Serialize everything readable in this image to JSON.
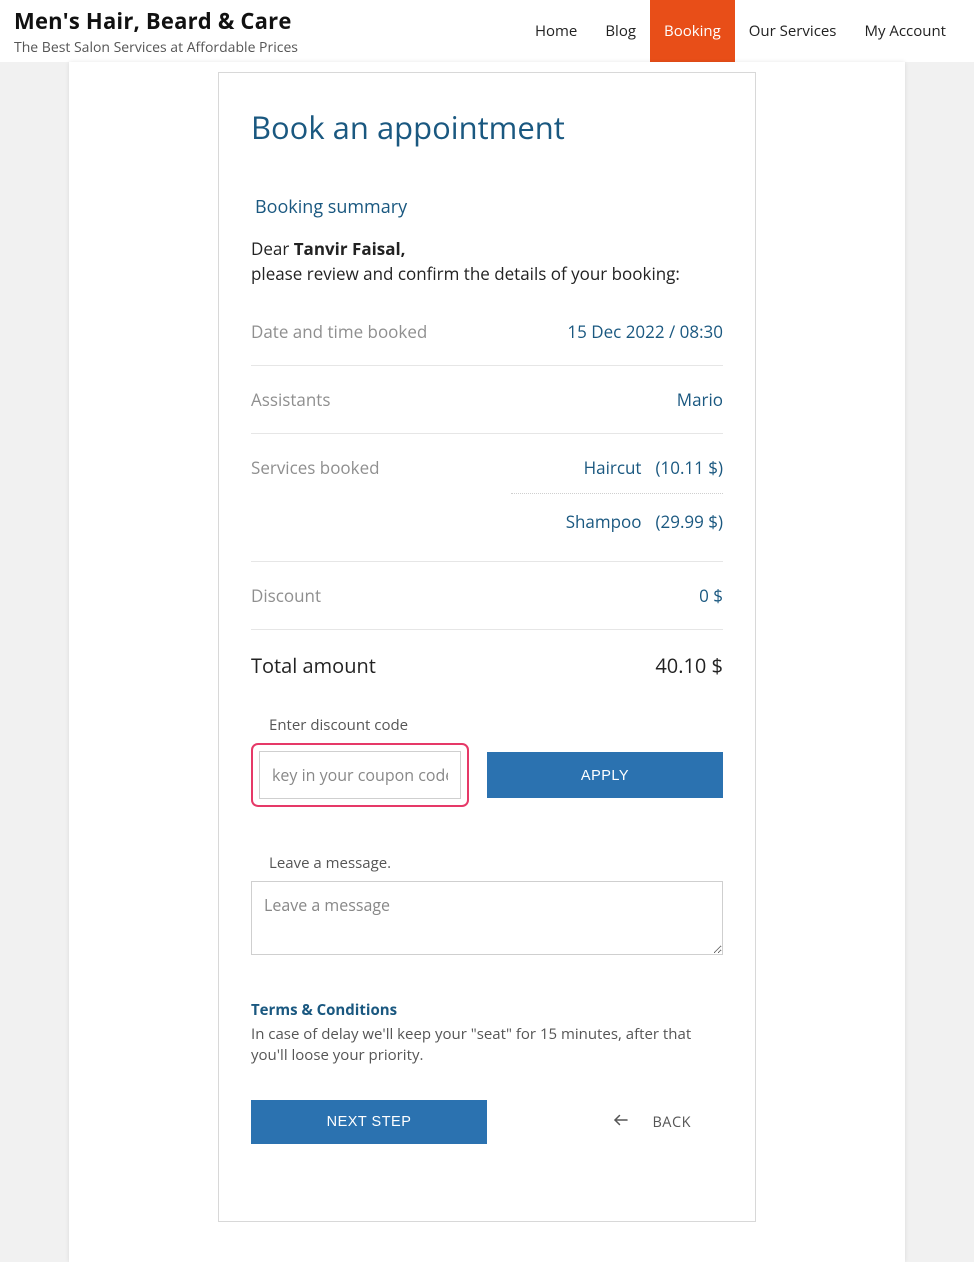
{
  "brand": {
    "title": "Men's Hair, Beard & Care",
    "subtitle": "The Best Salon Services at Affordable Prices"
  },
  "nav": {
    "items": [
      {
        "label": "Home",
        "active": false
      },
      {
        "label": "Blog",
        "active": false
      },
      {
        "label": "Booking",
        "active": true
      },
      {
        "label": "Our Services",
        "active": false
      },
      {
        "label": "My Account",
        "active": false
      }
    ]
  },
  "booking": {
    "title": "Book an appointment",
    "summary_heading": "Booking summary",
    "dear_prefix": "Dear ",
    "customer_name": "Tanvir Faisal,",
    "dear_instruction": "please review and confirm the details of your booking:",
    "date_label": "Date and time booked",
    "date_value": "15 Dec 2022 / 08:30",
    "assistants_label": "Assistants",
    "assistants_value": "Mario",
    "services_label": "Services booked",
    "services": [
      {
        "name": "Haircut",
        "price": "(10.11 $)"
      },
      {
        "name": "Shampoo",
        "price": "(29.99 $)"
      }
    ],
    "discount_label": "Discount",
    "discount_value": "0 $",
    "total_label": "Total amount",
    "total_value": "40.10 $",
    "coupon_label": "Enter discount code",
    "coupon_placeholder": "key in your coupon code",
    "apply_label": "APPLY",
    "msg_label": "Leave a message.",
    "msg_placeholder": "Leave a message",
    "terms_title": "Terms & Conditions",
    "terms_body": "In case of delay we'll keep your \"seat\" for 15 minutes, after that you'll loose your priority.",
    "next_label": "NEXT STEP",
    "back_label": "BACK"
  }
}
